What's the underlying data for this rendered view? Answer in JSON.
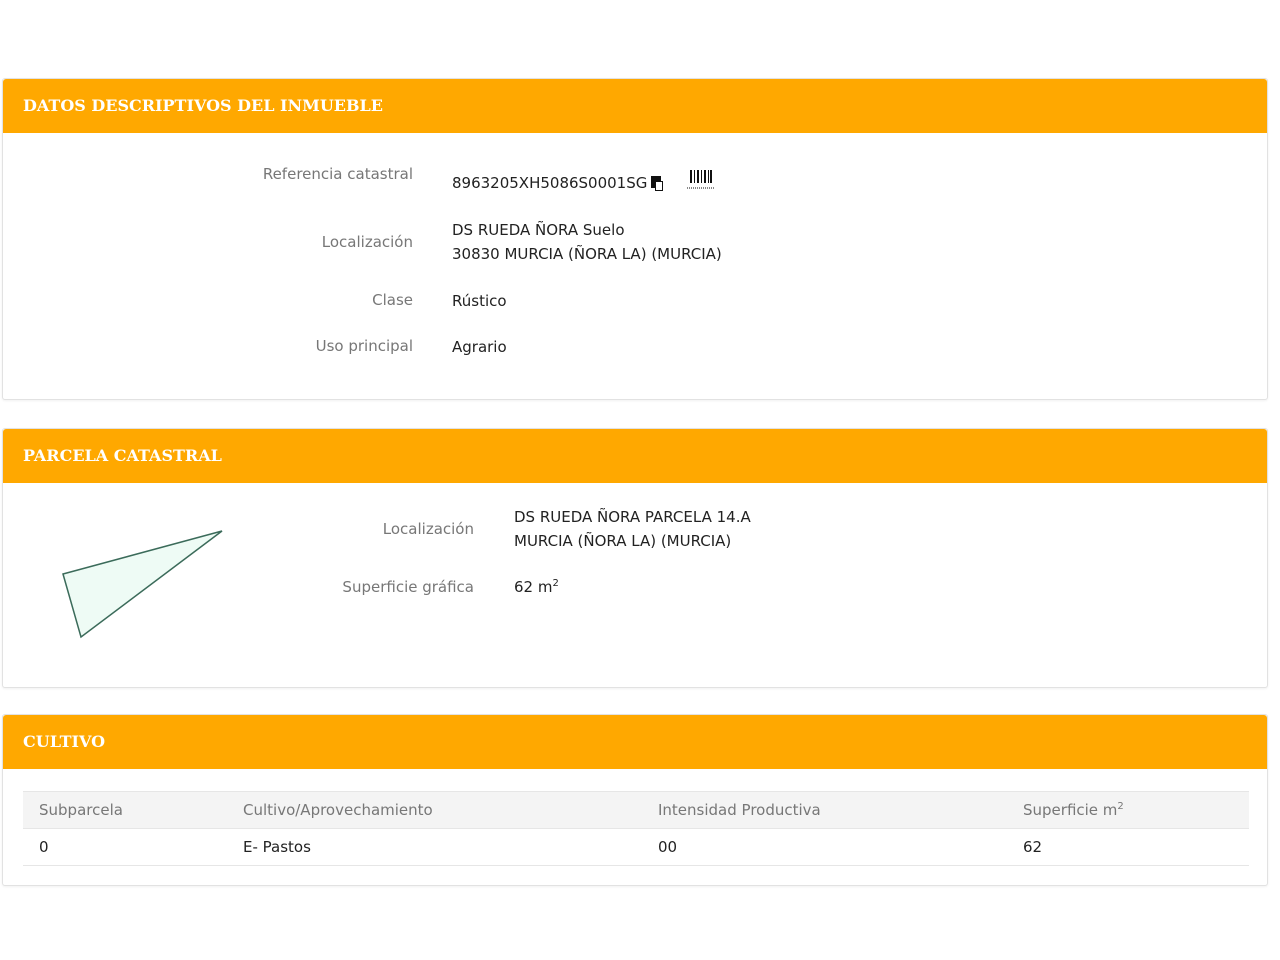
{
  "descriptivos": {
    "title": "DATOS DESCRIPTIVOS DEL INMUEBLE",
    "referencia_label": "Referencia catastral",
    "referencia_value": "8963205XH5086S0001SG",
    "localizacion_label": "Localización",
    "localizacion_line1": "DS RUEDA ÑORA Suelo",
    "localizacion_line2": "30830 MURCIA (ÑORA LA) (MURCIA)",
    "clase_label": "Clase",
    "clase_value": "Rústico",
    "uso_label": "Uso principal",
    "uso_value": "Agrario",
    "icons": [
      "copy-icon",
      "barcode-icon"
    ]
  },
  "parcela": {
    "title": "PARCELA CATASTRAL",
    "localizacion_label": "Localización",
    "localizacion_line1": "DS RUEDA ÑORA PARCELA 14.A",
    "localizacion_line2": "MURCIA (ÑORA LA) (MURCIA)",
    "superficie_label": "Superficie gráfica",
    "superficie_value": "62 m",
    "superficie_sup": "2",
    "shape_fill": "#eefbf5",
    "shape_stroke": "#3b6b5a"
  },
  "cultivo": {
    "title": "CULTIVO",
    "headers": [
      "Subparcela",
      "Cultivo/Aprovechamiento",
      "Intensidad Productiva",
      "Superficie m"
    ],
    "header_sup": "2",
    "rows": [
      [
        "0",
        "E- Pastos",
        "00",
        "62"
      ]
    ]
  },
  "colors": {
    "header_bg": "#FFA800",
    "header_text": "#ffffff",
    "label_text": "#777777"
  }
}
